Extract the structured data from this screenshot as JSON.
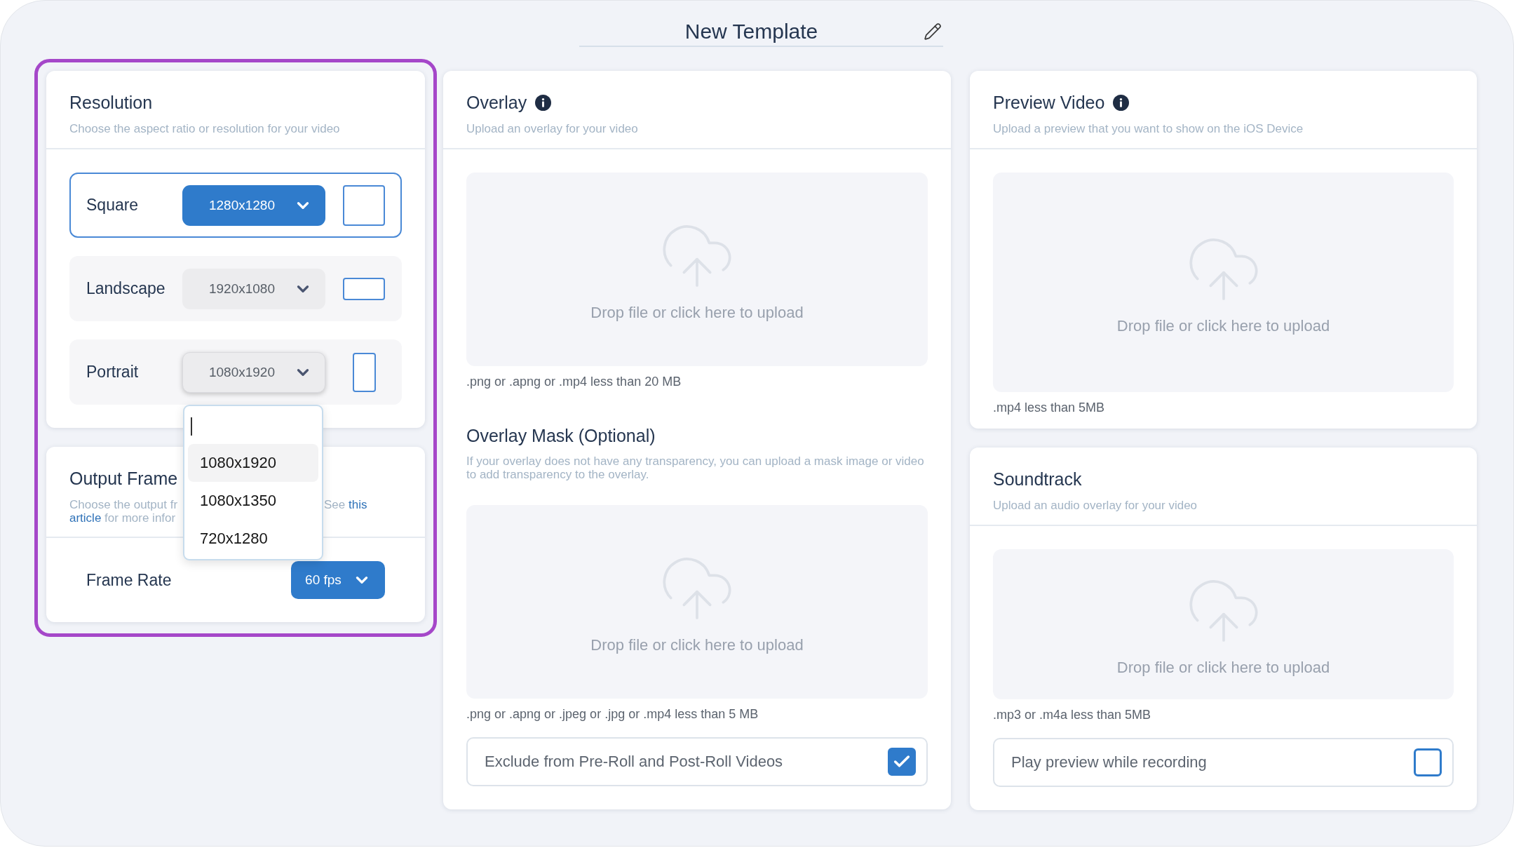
{
  "title": "New Template",
  "left_panel": {
    "highlighted": true,
    "resolution": {
      "title": "Resolution",
      "subtitle": "Choose the aspect ratio or resolution for your video",
      "options": [
        {
          "label": "Square",
          "kind": "square",
          "value": "1280x1280",
          "selected": true,
          "expanded": false
        },
        {
          "label": "Landscape",
          "kind": "landscape",
          "value": "1920x1080",
          "selected": false,
          "expanded": false
        },
        {
          "label": "Portrait",
          "kind": "portrait",
          "value": "1080x1920",
          "selected": false,
          "expanded": true,
          "menu": {
            "search": {
              "focused": true
            },
            "items": [
              {
                "label": "1080x1920",
                "selected": true
              },
              {
                "label": "1080x1350",
                "selected": false
              },
              {
                "label": "720x1280",
                "selected": false
              }
            ]
          }
        }
      ]
    },
    "output_frame": {
      "title": "Output Frame",
      "description": [
        {
          "left": [
            {
              "kind": "text",
              "text": "Choose the output fr"
            }
          ],
          "right": [
            {
              "kind": "text",
              "text": "See"
            },
            {
              "kind": "link",
              "text": "this"
            }
          ]
        },
        {
          "left": [
            {
              "kind": "link",
              "text": "article"
            },
            {
              "kind": "text",
              "text": "for more infor"
            }
          ]
        }
      ],
      "frame_rate": {
        "label": "Frame Rate",
        "value": "60 fps"
      }
    }
  },
  "overlay": {
    "title": "Overlay",
    "info": true,
    "subtitle": "Upload an overlay for your video",
    "upload": {
      "prompt": "Drop file or click here to upload",
      "hint": ".png or .apng or .mp4 less than 20 MB"
    },
    "mask": {
      "title": "Overlay Mask (Optional)",
      "description": "If your overlay does not have any transparency, you can upload a mask image or video to add transparency to the overlay.",
      "upload": {
        "prompt": "Drop file or click here to upload",
        "hint": ".png or .apng or .jpeg or .jpg or .mp4 less than 5 MB"
      },
      "option": {
        "label": "Exclude from Pre-Roll and Post-Roll Videos",
        "checked": true
      }
    }
  },
  "preview_video": {
    "title": "Preview Video",
    "info": true,
    "subtitle": "Upload a preview that you want to show on the iOS Device",
    "upload": {
      "prompt": "Drop file or click here to upload",
      "hint": ".mp4 less than 5MB"
    }
  },
  "soundtrack": {
    "title": "Soundtrack",
    "subtitle": "Upload an audio overlay for your video",
    "upload": {
      "prompt": "Drop file or click here to upload",
      "hint": ".mp3 or .m4a less than 5MB"
    },
    "option": {
      "label": "Play preview while recording",
      "checked": false
    }
  }
}
